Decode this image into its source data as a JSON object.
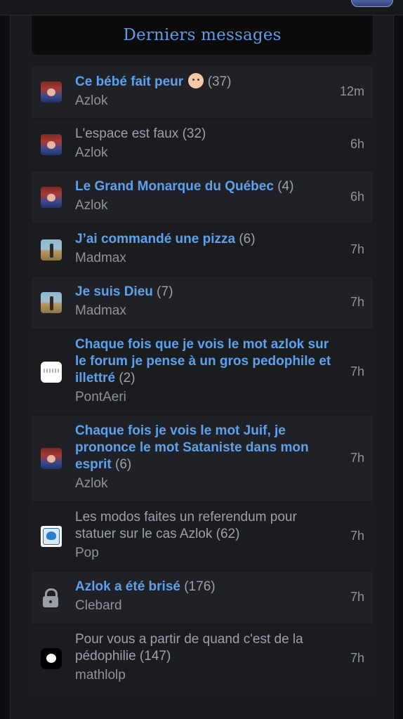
{
  "header": {
    "title": "Derniers messages"
  },
  "topics": [
    {
      "title": "Ce bébé fait peur",
      "emoji": true,
      "count": "(37)",
      "author": "Azlok",
      "time": "12m",
      "unread": true,
      "avatar": "azlok"
    },
    {
      "title": "L'espace est faux",
      "count": "(32)",
      "author": "Azlok",
      "time": "6h",
      "unread": false,
      "avatar": "azlok"
    },
    {
      "title": "Le Grand Monarque du Québec",
      "count": "(4)",
      "author": "Azlok",
      "time": "6h",
      "unread": true,
      "avatar": "azlok"
    },
    {
      "title": "J’ai commandé une pizza",
      "count": "(6)",
      "author": "Madmax",
      "time": "7h",
      "unread": true,
      "avatar": "madmax"
    },
    {
      "title": "Je suis Dieu",
      "count": "(7)",
      "author": "Madmax",
      "time": "7h",
      "unread": true,
      "avatar": "madmax"
    },
    {
      "title": "Chaque fois que je vois le mot azlok sur le forum je pense à un gros pedophile et illettré",
      "count": "(2)",
      "author": "PontAeri",
      "time": "7h",
      "unread": true,
      "avatar": "pontaeri"
    },
    {
      "title": "Chaque fois je vois le mot Juif, je prononce le mot Sataniste dans mon esprit",
      "count": "(6)",
      "author": "Azlok",
      "time": "7h",
      "unread": true,
      "avatar": "azlok"
    },
    {
      "title": "Les modos faites un referendum pour statuer sur le cas Azlok",
      "count": "(62)",
      "author": "Pop",
      "time": "7h",
      "unread": false,
      "avatar": "pop"
    },
    {
      "title": "Azlok a été brisé",
      "count": "(176)",
      "author": "Clebard",
      "time": "7h",
      "unread": true,
      "avatar": "lock"
    },
    {
      "title": "Pour vous a partir de quand c'est de la pédophilie",
      "count": "(147)",
      "author": "mathlolp",
      "time": "7h",
      "unread": false,
      "avatar": "mathlolp"
    }
  ],
  "colors": {
    "accent": "#5ea1ea",
    "muted": "#9ca0a8",
    "background": "#0e0e10"
  }
}
